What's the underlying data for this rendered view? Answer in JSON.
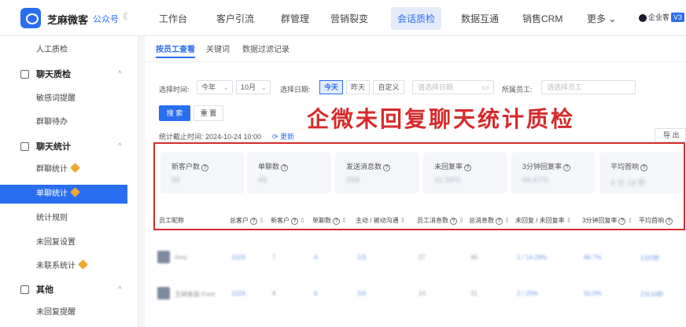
{
  "brand": {
    "name": "芝麻微客",
    "sub": "公众号"
  },
  "top_nav": [
    "工作台",
    "客户引流",
    "群管理",
    "营销裂变",
    "会话质检",
    "数据互通",
    "销售CRM",
    "更多"
  ],
  "top_nav_active": "会话质检",
  "qiye": {
    "label": "企业客",
    "version": "V3"
  },
  "sidebar": {
    "top_item": "人工质检",
    "groups": [
      {
        "label": "聊天质检",
        "items": [
          "敏感词提醒",
          "群聊待办"
        ]
      },
      {
        "label": "聊天统计",
        "items": [
          "群聊统计",
          "单聊统计",
          "统计规则",
          "未回复设置",
          "未联系统计"
        ]
      },
      {
        "label": "其他",
        "items": [
          "未回复提醒"
        ]
      }
    ],
    "active_item": "单聊统计"
  },
  "subtabs": [
    "按员工查看",
    "关键词",
    "数据过滤记录"
  ],
  "filters": {
    "time_label": "选择时间:",
    "year": "今年",
    "month": "10月",
    "date_label": "选择日期:",
    "date_buttons": [
      "今天",
      "昨天",
      "自定义"
    ],
    "date_placeholder": "请选择日期",
    "staff_label": "所属员工:",
    "staff_placeholder": "请选择员工"
  },
  "buttons": {
    "search": "搜 索",
    "reset": "重 置",
    "export": "导 出"
  },
  "stat_time": "统计截止时间: 2024-10-24 10:00",
  "refresh": "更新",
  "overlay_title": "企微未回复聊天统计质检",
  "cards": [
    {
      "label": "新客户数",
      "value": "56"
    },
    {
      "label": "单聊数",
      "value": "49"
    },
    {
      "label": "发送消息数",
      "value": "269"
    },
    {
      "label": "未回复率",
      "value": "41.56%"
    },
    {
      "label": "3分钟回复率",
      "value": "66.67%"
    },
    {
      "label": "平均首响",
      "value": "4 分 19 秒"
    }
  ],
  "table_headers": [
    "员工昵称",
    "总客户",
    "新客户",
    "单聊数",
    "主动 / 被动沟通",
    "员工消息数",
    "总消息数",
    "未回复 / 未回复率",
    "3分钟回复率",
    "平均首响"
  ],
  "rows": [
    {
      "name": "Amy",
      "cells": [
        "1029",
        "7",
        "4",
        "1/3",
        "27",
        "46",
        "1 / 14.29%",
        "66.7%",
        "1分5秒"
      ]
    },
    {
      "name": "芝麻客服 Fred",
      "cells": [
        "1024",
        "8",
        "6",
        "2/4",
        "24",
        "31",
        "2 / 25%",
        "50.0%",
        "2分10秒"
      ]
    }
  ]
}
